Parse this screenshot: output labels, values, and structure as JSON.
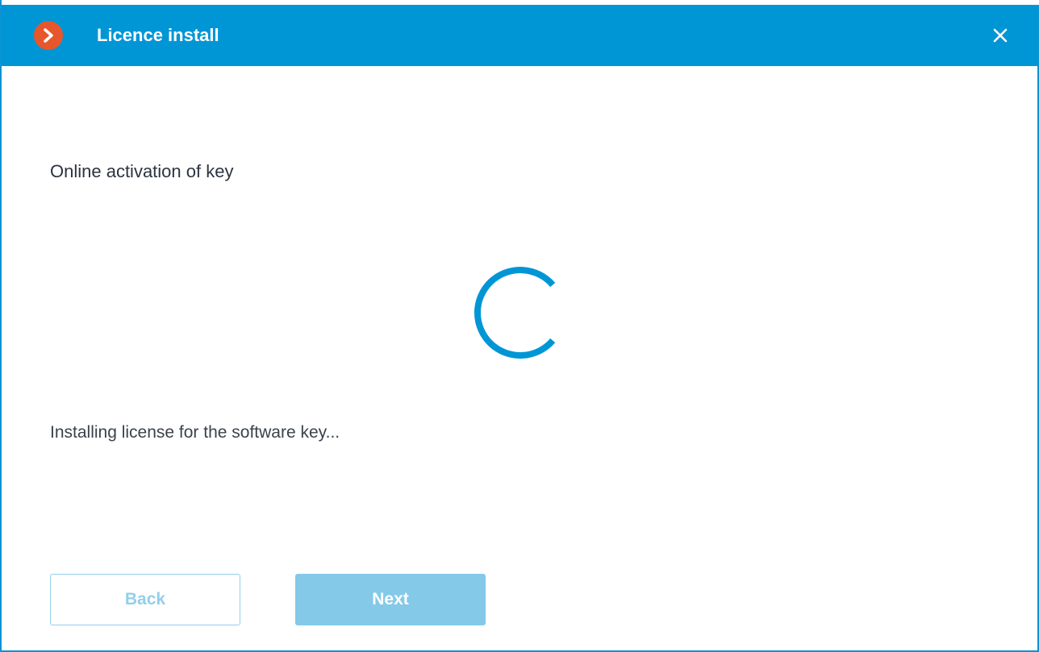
{
  "window": {
    "title": "Licence install",
    "logo_icon": "chevron-right-icon",
    "close_icon": "close-icon"
  },
  "content": {
    "heading": "Online activation of key",
    "status": "Installing license for the software key..."
  },
  "buttons": {
    "back_label": "Back",
    "next_label": "Next"
  },
  "colors": {
    "titlebar": "#0096d6",
    "logo": "#e8562b",
    "spinner": "#0096d6",
    "button_disabled": "#84c9e8"
  }
}
